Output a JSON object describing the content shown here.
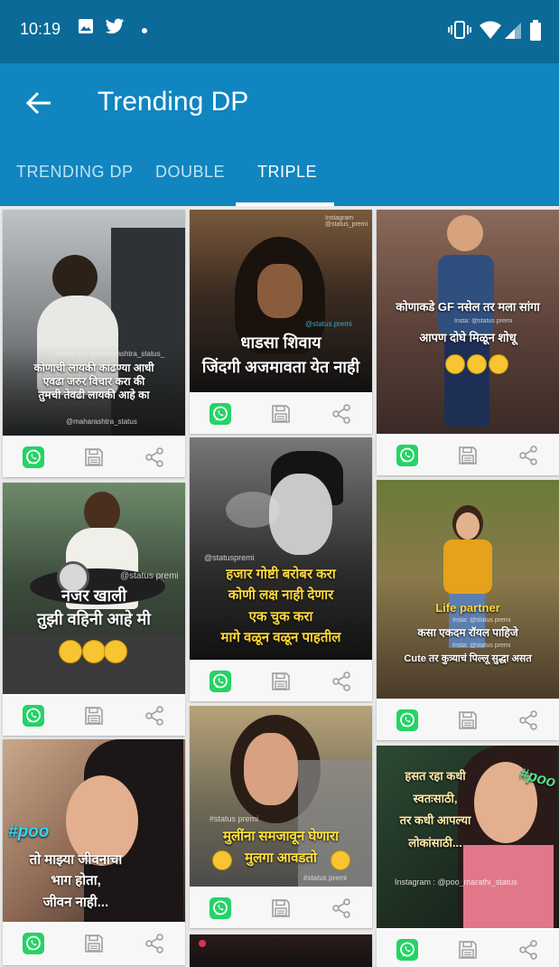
{
  "status_bar": {
    "time": "10:19"
  },
  "app_bar": {
    "title": "Trending DP"
  },
  "tabs": [
    {
      "label": "TRENDING DP",
      "active": false
    },
    {
      "label": "DOUBLE",
      "active": false
    },
    {
      "label": "TRIPLE",
      "active": true
    }
  ],
  "colors": {
    "status_bar": "#0b6a98",
    "app_bar": "#1185bf",
    "whatsapp": "#25d366",
    "icon_gray": "#9e9e9e"
  },
  "cards": {
    "c1": {
      "watermark_top": "Instagram @maharashtra_status_",
      "lines": [
        "कोणाची लायकी काढण्या आधी",
        "एवढा जरुर विचार करा की",
        "तुमची तेवढी लायकी आहे का"
      ],
      "watermark_bottom": "@maharashtra_status"
    },
    "c2": {
      "watermark_top": "Instagram @status_premi",
      "tag": "@status premi",
      "lines": [
        "धाडसा शिवाय",
        "जिंदगी अजमावता येत नाही"
      ],
      "highlight": "अजमावता"
    },
    "c3": {
      "lines": [
        "कोणाकडे GF नसेल तर मला सांगा",
        "आपण दोघे मिळून शोधू"
      ],
      "tag": "Insta: @status premi"
    },
    "c4": {
      "tag": "@status premi",
      "lines": [
        "नजर खाली",
        "तुझी वहिनी आहे मी"
      ]
    },
    "c5": {
      "tag": "@statuspremi",
      "lines": [
        "हजार गोष्टी बरोबर करा",
        "कोणी लक्ष नाही देणार",
        "एक चुक करा",
        "मागे वळून वळून पाहतील"
      ]
    },
    "c6": {
      "heading": "Life partner",
      "tag": "Insta: @status premi",
      "lines": [
        "कसा एकदम रॉयल पाहिजे",
        "Cute तर कुत्र्याचं पिल्लू सुद्धा असत"
      ],
      "tag2": "Insta: @status premi"
    },
    "c7": {
      "hashtag": "#poo",
      "lines": [
        "तो माझ्या जीवनाचा",
        "भाग होता,",
        "जीवन नाही..."
      ]
    },
    "c8": {
      "tag": "#status premi",
      "lines": [
        "मुलींना समजावून घेणारा",
        "मुलगा आवडतो"
      ],
      "tag2": "#status premi"
    },
    "c9": {
      "hashtag": "#poo",
      "lines": [
        "हसत रहा कधी",
        "स्वतःसाठी,",
        "तर कधी आपल्या",
        "लोकांसाठी..."
      ],
      "watermark_bottom": "Instagram : @poo_marathi_status"
    }
  }
}
